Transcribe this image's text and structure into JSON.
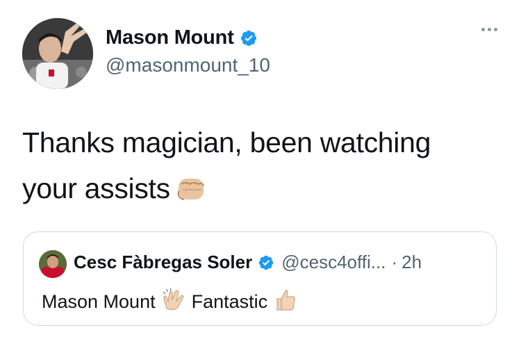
{
  "tweet": {
    "display_name": "Mason Mount",
    "handle": "@masonmount_10",
    "verified": true,
    "text": "Thanks magician, been watching your assists",
    "text_emoji": "oncoming-fist-light-skin-tone-icon",
    "more_icon": "more-horizontal-icon"
  },
  "quoted": {
    "display_name": "Cesc Fàbregas Soler",
    "handle": "@cesc4offi...",
    "separator": "·",
    "time": "2h",
    "verified": true,
    "text_part1": "Mason Mount",
    "emoji1": "clapping-hands-light-skin-tone-icon",
    "text_part2": "Fantastic",
    "emoji2": "thumbs-up-light-skin-tone-icon"
  },
  "colors": {
    "verified_blue": "#1d9bf0",
    "secondary_text": "#536471",
    "border": "#cfd9de"
  }
}
